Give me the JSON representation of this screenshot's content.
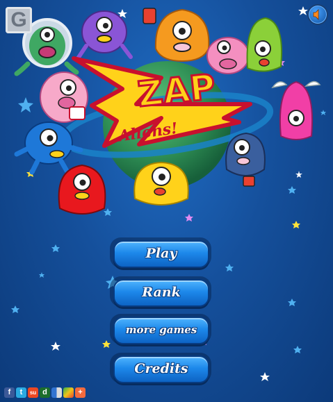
{
  "game": {
    "title_word": "ZAP",
    "subtitle_word": "Aliens!"
  },
  "corner_logo": {
    "glyph": "G",
    "icon": "game-site-logo-icon"
  },
  "sound": {
    "icon": "speaker-icon"
  },
  "menu": {
    "play_label": "Play",
    "rank_label": "Rank",
    "more_games_label": "more games",
    "credits_label": "Credits"
  },
  "share": {
    "icons": [
      "facebook-icon",
      "twitter-icon",
      "stumbleupon-icon",
      "digg-icon",
      "delicious-icon",
      "share-plus-icon"
    ],
    "glyphs": [
      "f",
      "t",
      "su",
      "d",
      "",
      "+"
    ],
    "colors": [
      "#3b5998",
      "#2aa9e0",
      "#eb4823",
      "#1c6e2b",
      "#3274d1",
      "#f26a3d"
    ]
  },
  "colors": {
    "background": "#15509c",
    "button": "#1d88ea",
    "title_fill": "#ffd21a",
    "title_outline": "#c8102e"
  }
}
